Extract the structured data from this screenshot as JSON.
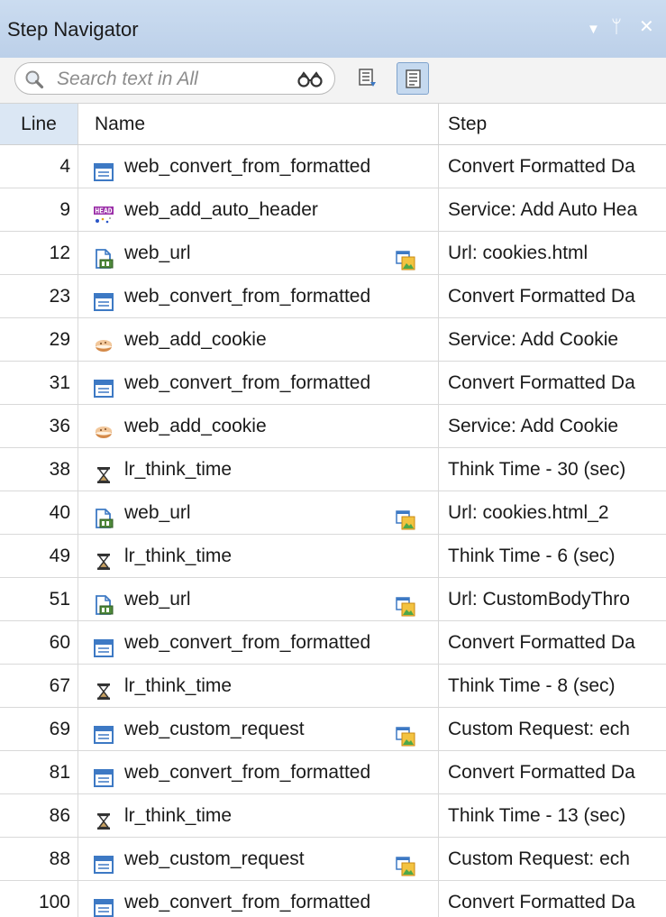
{
  "panel": {
    "title": "Step Navigator",
    "controls": {
      "menu": "▼",
      "pin": "ᛘ",
      "close": "✕"
    }
  },
  "toolbar": {
    "search_placeholder": "Search text in All",
    "icons": [
      "search-icon",
      "binoculars-icon",
      "list-view-icon",
      "detail-view-icon"
    ]
  },
  "table": {
    "headers": {
      "line": "Line",
      "name": "Name",
      "step": "Step"
    },
    "rows": [
      {
        "line": "4",
        "name": "web_convert_from_formatted",
        "step": "Convert Formatted Da",
        "icon": "window-icon",
        "has_snapshot": false
      },
      {
        "line": "9",
        "name": "web_add_auto_header",
        "step": "Service: Add Auto Hea",
        "icon": "header-icon",
        "has_snapshot": false
      },
      {
        "line": "12",
        "name": "web_url",
        "step": "Url: cookies.html",
        "icon": "url-icon",
        "has_snapshot": true
      },
      {
        "line": "23",
        "name": "web_convert_from_formatted",
        "step": "Convert Formatted Da",
        "icon": "window-icon",
        "has_snapshot": false
      },
      {
        "line": "29",
        "name": "web_add_cookie",
        "step": "Service: Add Cookie",
        "icon": "cookie-icon",
        "has_snapshot": false
      },
      {
        "line": "31",
        "name": "web_convert_from_formatted",
        "step": "Convert Formatted Da",
        "icon": "window-icon",
        "has_snapshot": false
      },
      {
        "line": "36",
        "name": "web_add_cookie",
        "step": "Service: Add Cookie",
        "icon": "cookie-icon",
        "has_snapshot": false
      },
      {
        "line": "38",
        "name": "lr_think_time",
        "step": "Think Time - 30 (sec)",
        "icon": "hourglass-icon",
        "has_snapshot": false
      },
      {
        "line": "40",
        "name": "web_url",
        "step": "Url: cookies.html_2",
        "icon": "url-icon",
        "has_snapshot": true
      },
      {
        "line": "49",
        "name": "lr_think_time",
        "step": "Think Time - 6 (sec)",
        "icon": "hourglass-icon",
        "has_snapshot": false
      },
      {
        "line": "51",
        "name": "web_url",
        "step": "Url: CustomBodyThro",
        "icon": "url-icon",
        "has_snapshot": true
      },
      {
        "line": "60",
        "name": "web_convert_from_formatted",
        "step": "Convert Formatted Da",
        "icon": "window-icon",
        "has_snapshot": false
      },
      {
        "line": "67",
        "name": "lr_think_time",
        "step": "Think Time - 8 (sec)",
        "icon": "hourglass-icon",
        "has_snapshot": false
      },
      {
        "line": "69",
        "name": "web_custom_request",
        "step": "Custom Request: ech",
        "icon": "window-icon",
        "has_snapshot": true
      },
      {
        "line": "81",
        "name": "web_convert_from_formatted",
        "step": "Convert Formatted Da",
        "icon": "window-icon",
        "has_snapshot": false
      },
      {
        "line": "86",
        "name": "lr_think_time",
        "step": "Think Time - 13 (sec)",
        "icon": "hourglass-icon",
        "has_snapshot": false
      },
      {
        "line": "88",
        "name": "web_custom_request",
        "step": "Custom Request: ech",
        "icon": "window-icon",
        "has_snapshot": true
      },
      {
        "line": "100",
        "name": "web_convert_from_formatted",
        "step": "Convert Formatted Da",
        "icon": "window-icon",
        "has_snapshot": false
      }
    ]
  },
  "colors": {
    "titlebar": "#c4d7ee",
    "header_line_bg": "#dbe7f4",
    "grid": "#d9d9d9",
    "icon_blue": "#3d79c4"
  }
}
